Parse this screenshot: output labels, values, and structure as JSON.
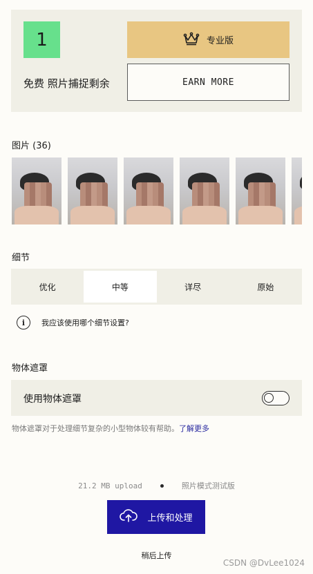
{
  "credits": {
    "count": "1",
    "label": "免费 照片捕捉剩余"
  },
  "pro_button": {
    "label": "专业版",
    "icon": "crown-icon"
  },
  "earn_more": {
    "label": "EARN MORE"
  },
  "photos": {
    "title": "图片 (36)",
    "count": 6
  },
  "detail": {
    "title": "细节",
    "options": [
      "优化",
      "中等",
      "详尽",
      "原始"
    ],
    "selected": "中等",
    "help": "我应该使用哪个细节设置?"
  },
  "object_mask": {
    "title": "物体遮罩",
    "toggle_label": "使用物体遮罩",
    "enabled": false,
    "description": "物体遮罩对于处理细节复杂的小型物体较有帮助。",
    "learn_more": "了解更多"
  },
  "upload": {
    "size": "21.2 MB upload",
    "mode": "照片模式测试版",
    "button": "上传和处理",
    "later": "稍后上传"
  },
  "watermark": "CSDN @DvLee1024",
  "colors": {
    "credit_green": "#67e08c",
    "pro_gold": "#e8c682",
    "primary_blue": "#1f17a3",
    "panel_bg": "#f0efe6",
    "page_bg": "#fdfcf8"
  }
}
